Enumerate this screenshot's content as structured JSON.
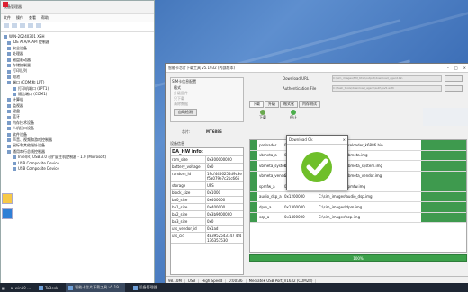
{
  "device_manager": {
    "title": "设备管理器",
    "menu": [
      "文件",
      "操作",
      "查看",
      "帮助"
    ],
    "tree": [
      "WIN-20240301 XSH",
      "IDE ATA/ATAPI 控制器",
      "安全设备",
      "处理器",
      "磁盘驱动器",
      "存储控制器",
      "打印队列",
      "电池",
      "端口 (COM 和 LPT)",
      "打印机端口 (LPT1)",
      "通信端口 (COM1)",
      "计算机",
      "监视器",
      "键盘",
      "蓝牙",
      "内存技术设备",
      "人机接口设备",
      "软件设备",
      "声音、视频和游戏控制器",
      "鼠标和其他指针设备",
      "通用串行总线控制器",
      "Intel(R) USB 3.0 可扩展主机控制器 - 1.0 (Microsoft)",
      "USB Composite Device",
      "USB Composite Device"
    ]
  },
  "flash_tool": {
    "title": "智能卡芯片下载工具 v5.1932 (内部版本)",
    "download_url_label": "Download URL",
    "download_url_value": "C:\\sim_images\\NM_Ktxt\\output\\download_agent.bin",
    "auth_file_label": "Authentication File",
    "auth_file_value": "C:\\flash_tools\\download_agent\\auth_sv5.auth",
    "config_title": "SIM卡信息配置",
    "config_options": [
      "格式",
      "升级固件",
      "只下载",
      "清除数据"
    ],
    "config_button": "自动检测",
    "tabs": [
      "下载",
      "升级",
      "格式化",
      "内存测试"
    ],
    "active_tab": "下载",
    "download_button": "下载",
    "stop_button": "停止",
    "chip_label": "芯片:",
    "chip_value": "MT6886",
    "device_info_label": "设备信息",
    "da_info_header": "DA_HW info:",
    "da_info": [
      {
        "k": "ram_size",
        "v": "0x300000000"
      },
      {
        "k": "battery_voltage",
        "v": "0x0"
      },
      {
        "k": "random_id",
        "v": "19cf4456254d9c3ef5a079e7c21c666"
      },
      {
        "k": "storage",
        "v": "UFS"
      },
      {
        "k": "block_size",
        "v": "0x1000"
      },
      {
        "k": "ba0_size",
        "v": "0x400000"
      },
      {
        "k": "ba1_size",
        "v": "0x400000"
      },
      {
        "k": "ba2_size",
        "v": "0x3b9600000"
      },
      {
        "k": "ba3_size",
        "v": "0x0"
      },
      {
        "k": "ufs_vendor_id",
        "v": "0x1ad"
      },
      {
        "k": "ufs_cid",
        "v": "483952543147 4f4136353530"
      }
    ],
    "images": [
      {
        "name": "preloader",
        "size": "0x0",
        "path": "C:\\sim_images\\preloader_k6886.bin"
      },
      {
        "name": "vbmeta_a",
        "size": "0x1000000",
        "path": "C:\\sim_images\\vbmeta.img"
      },
      {
        "name": "vbmeta_system_a",
        "size": "0x1000000",
        "path": "C:\\sim_images\\vbmeta_system.img"
      },
      {
        "name": "vbmeta_vendor_a",
        "size": "0x1000000",
        "path": "C:\\sim_images\\vbmeta_vendor.img"
      },
      {
        "name": "spmfw_a",
        "size": "0x1100000",
        "path": "C:\\sim_images\\spmfw.img"
      },
      {
        "name": "audio_dsp_a",
        "size": "0x1200000",
        "path": "C:\\sim_images\\audio_dsp.img"
      },
      {
        "name": "dpm_a",
        "size": "0x1300000",
        "path": "C:\\sim_images\\dpm.img"
      },
      {
        "name": "scp_a",
        "size": "0x1400000",
        "path": "C:\\sim_images\\scp.img"
      }
    ],
    "progress_text": "100%",
    "progress": 1.0,
    "status": [
      "98.10M",
      "USB",
      "High Speed",
      "0:00:36",
      "Mediatek USB Port_V1632 (COM28)"
    ]
  },
  "ok_dialog": {
    "title": "Download Ok",
    "close": "×"
  },
  "taskbar": {
    "items": [
      "ToDesk",
      "智能卡芯片下载工具 v5.19...",
      "设备管理器"
    ],
    "tray_text": "ai-win10-..."
  },
  "colors": {
    "accent_green": "#3e9a4e",
    "check_green": "#6fbf2a",
    "desktop_blue": "#3d6fb7"
  }
}
